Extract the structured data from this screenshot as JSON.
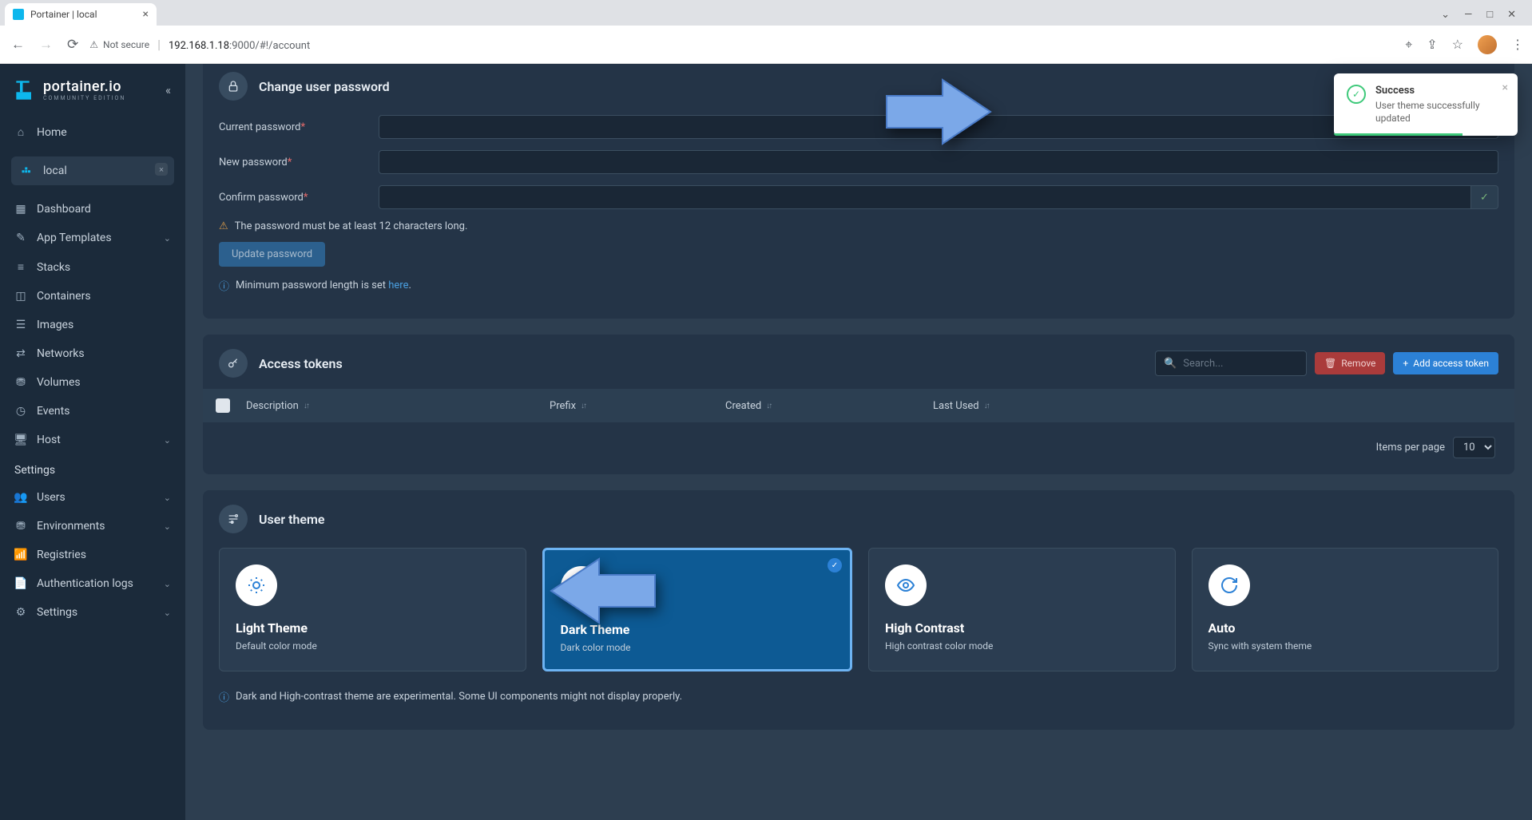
{
  "browser": {
    "tab_title": "Portainer | local",
    "security_label": "Not secure",
    "url_host": "192.168.1.18",
    "url_port_path": ":9000/#!/account"
  },
  "logo": {
    "name": "portainer.io",
    "edition": "COMMUNITY EDITION"
  },
  "sidebar": {
    "home": "Home",
    "env_name": "local",
    "items": [
      {
        "icon": "grid",
        "label": "Dashboard"
      },
      {
        "icon": "edit",
        "label": "App Templates",
        "chevron": true
      },
      {
        "icon": "layers",
        "label": "Stacks"
      },
      {
        "icon": "box",
        "label": "Containers"
      },
      {
        "icon": "list",
        "label": "Images"
      },
      {
        "icon": "share",
        "label": "Networks"
      },
      {
        "icon": "db",
        "label": "Volumes"
      },
      {
        "icon": "clock",
        "label": "Events"
      },
      {
        "icon": "server",
        "label": "Host",
        "chevron": true
      }
    ],
    "settings_title": "Settings",
    "settings_items": [
      {
        "icon": "users",
        "label": "Users",
        "chevron": true
      },
      {
        "icon": "env",
        "label": "Environments",
        "chevron": true
      },
      {
        "icon": "radio",
        "label": "Registries"
      },
      {
        "icon": "file",
        "label": "Authentication logs",
        "chevron": true
      },
      {
        "icon": "gear",
        "label": "Settings",
        "chevron": true
      }
    ]
  },
  "password_panel": {
    "title": "Change user password",
    "current_label": "Current password",
    "new_label": "New password",
    "confirm_label": "Confirm password",
    "hint": "The password must be at least 12 characters long.",
    "button": "Update password",
    "info_prefix": "Minimum password length is set ",
    "info_link": "here"
  },
  "tokens_panel": {
    "title": "Access tokens",
    "search_placeholder": "Search...",
    "remove_btn": "Remove",
    "add_btn": "Add access token",
    "columns": {
      "description": "Description",
      "prefix": "Prefix",
      "created": "Created",
      "last_used": "Last Used"
    },
    "pager_label": "Items per page",
    "pager_value": "10"
  },
  "theme_panel": {
    "title": "User theme",
    "cards": [
      {
        "name": "Light Theme",
        "desc": "Default color mode"
      },
      {
        "name": "Dark Theme",
        "desc": "Dark color mode"
      },
      {
        "name": "High Contrast",
        "desc": "High contrast color mode"
      },
      {
        "name": "Auto",
        "desc": "Sync with system theme"
      }
    ],
    "note": "Dark and High-contrast theme are experimental. Some UI components might not display properly."
  },
  "toast": {
    "title": "Success",
    "body": "User theme successfully updated"
  }
}
